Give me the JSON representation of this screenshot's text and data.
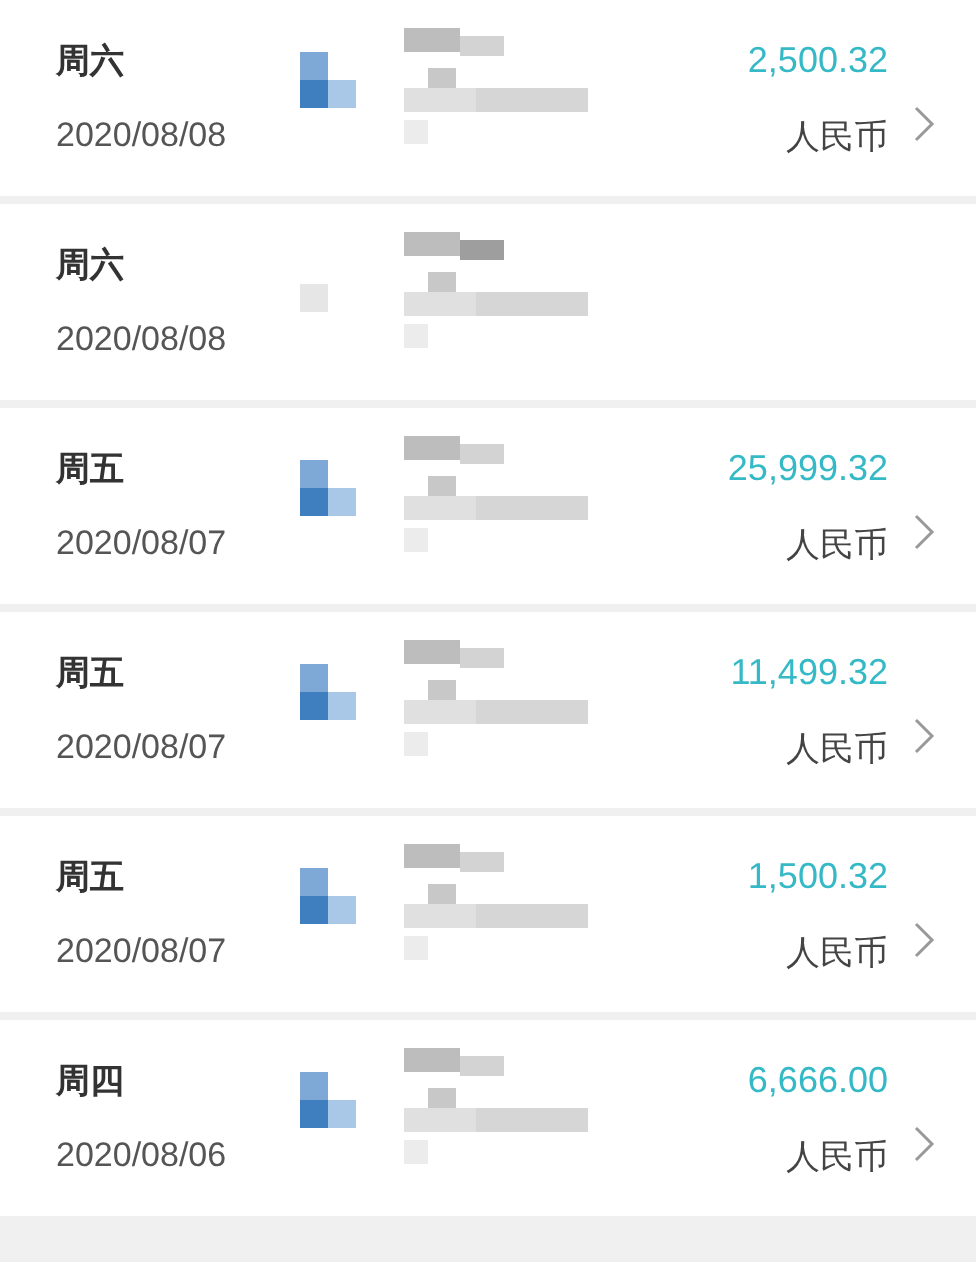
{
  "transactions": [
    {
      "weekday": "周六",
      "date": "2020/08/08",
      "amount": "2,500.32",
      "currency": "人民币"
    },
    {
      "weekday": "周六",
      "date": "2020/08/08"
    },
    {
      "weekday": "周五",
      "date": "2020/08/07",
      "amount": "25,999.32",
      "currency": "人民币"
    },
    {
      "weekday": "周五",
      "date": "2020/08/07",
      "amount": "11,499.32",
      "currency": "人民币"
    },
    {
      "weekday": "周五",
      "date": "2020/08/07",
      "amount": "1,500.32",
      "currency": "人民币"
    },
    {
      "weekday": "周四",
      "date": "2020/08/06",
      "amount": "6,666.00",
      "currency": "人民币"
    }
  ]
}
